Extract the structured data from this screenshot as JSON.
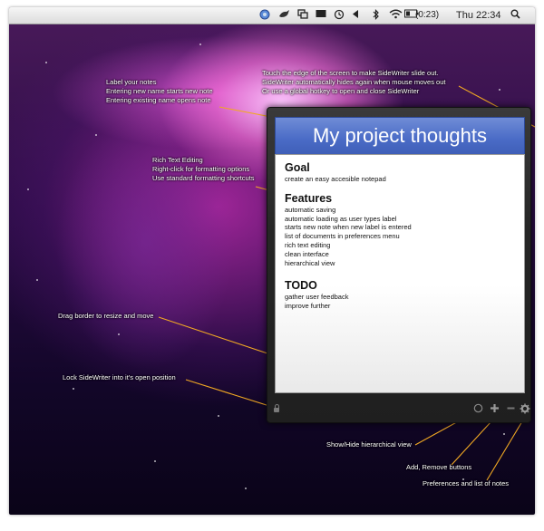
{
  "menubar": {
    "icons": [
      "app-icon",
      "bird-icon",
      "screens-icon",
      "folder-icon",
      "time-machine-icon",
      "volume-icon",
      "bluetooth-icon",
      "wifi-icon",
      "battery-icon",
      "spotlight-icon"
    ],
    "battery_time": "(0:23)",
    "clock": "Thu 22:34"
  },
  "sidewriter": {
    "title": "My project thoughts",
    "sections": [
      {
        "heading": "Goal",
        "lines": [
          "create an easy accesible notepad"
        ]
      },
      {
        "heading": "Features",
        "lines": [
          "automatic saving",
          "automatic loading as user types label",
          "starts new note when new label is entered",
          "list of documents in preferences menu",
          "rich text editing",
          "clean interface",
          "hierarchical view"
        ]
      },
      {
        "heading": "TODO",
        "lines": [
          "gather user feedback",
          "improve further"
        ]
      }
    ]
  },
  "annotations": {
    "label": [
      "Label your notes",
      "Entering new name starts new note",
      "Entering existing name opens note"
    ],
    "slide": [
      "Touch the edge of the screen to make SideWriter slide out.",
      "SideWriter automatically hides again when mouse moves out",
      "Or use a global hotkey to open and close SideWriter"
    ],
    "richtext": [
      "Rich Text Editing",
      "Right-click for formatting options",
      "Use standard formatting shortcuts"
    ],
    "drag": "Drag border to resize and move",
    "lock": "Lock SideWriter into it's open position",
    "hier": "Show/Hide hierarchical view",
    "addremove": "Add, Remove buttons",
    "prefs": "Preferences and list of notes"
  },
  "colors": {
    "title_bar": "#4a6bc6",
    "annotation_line": "#e0a020"
  }
}
